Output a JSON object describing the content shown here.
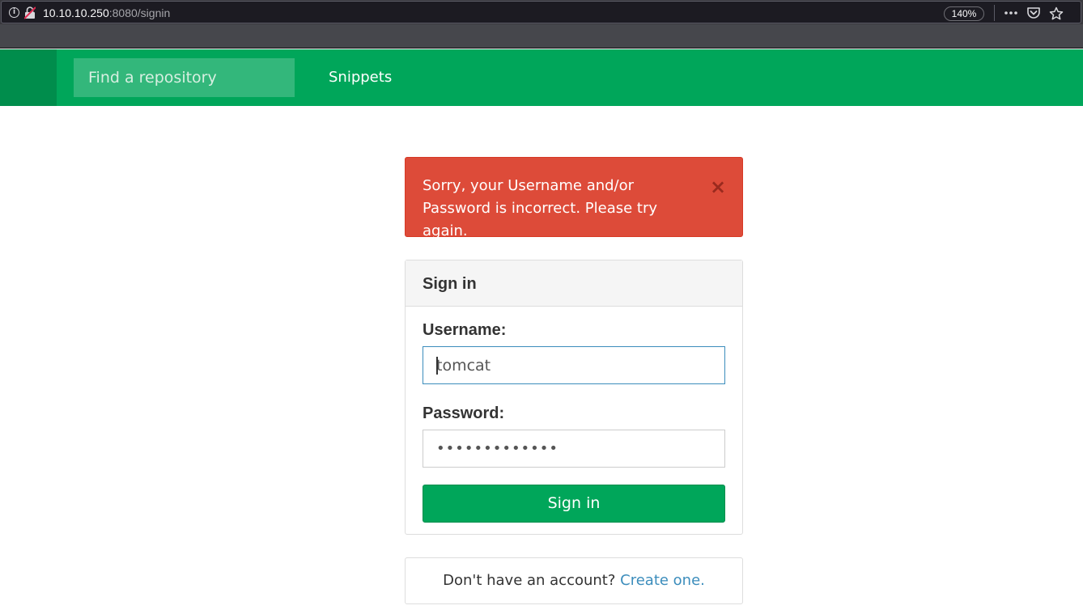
{
  "browser": {
    "url_host": "10.10.10.250",
    "url_path": ":8080/signin",
    "zoom": "140%",
    "info_icon": "i",
    "icons": [
      "info-icon",
      "insecure-lock-icon",
      "more-icon",
      "pocket-icon",
      "bookmark-star-icon"
    ]
  },
  "navbar": {
    "search_placeholder": "Find a repository",
    "snippets_label": "Snippets",
    "color": "#00a65a"
  },
  "alert": {
    "message": "Sorry, your Username and/or Password is incorrect. Please try again.",
    "close_symbol": "×",
    "color": "#dd4b39"
  },
  "signin_panel": {
    "title": "Sign in",
    "username_label": "Username:",
    "username_value": "tomcat",
    "password_label": "Password:",
    "password_value": "•••••••••••••",
    "submit_label": "Sign in"
  },
  "signup": {
    "prompt": "Don't have an account? ",
    "link_label": "Create one.",
    "link_color": "#3c8dbc"
  }
}
